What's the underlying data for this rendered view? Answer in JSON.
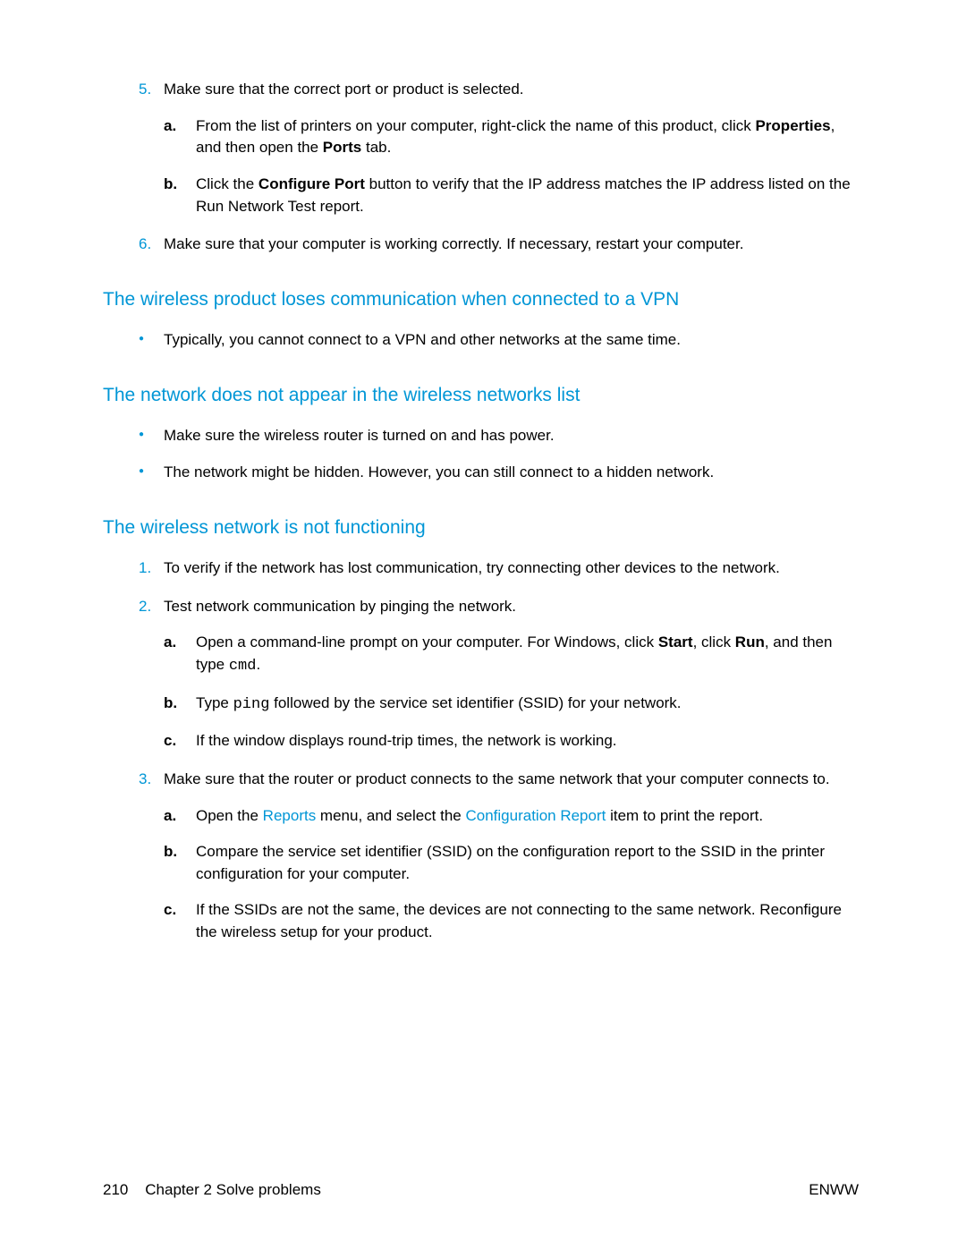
{
  "section1": {
    "item5_text": "Make sure that the correct port or product is selected.",
    "sub_a_1": "From the list of printers on your computer, right-click the name of this product, click ",
    "sub_a_b1": "Properties",
    "sub_a_2": ", and then open the ",
    "sub_a_b2": "Ports",
    "sub_a_3": " tab.",
    "sub_b_1": "Click the ",
    "sub_b_b1": "Configure Port",
    "sub_b_2": " button to verify that the IP address matches the IP address listed on the Run Network Test report.",
    "item6_text": "Make sure that your computer is working correctly. If necessary, restart your computer."
  },
  "heading1": "The wireless product loses communication when connected to a VPN",
  "vpn_bullet": "Typically, you cannot connect to a VPN and other networks at the same time.",
  "heading2": "The network does not appear in the wireless networks list",
  "net_bullet1": "Make sure the wireless router is turned on and has power.",
  "net_bullet2": "The network might be hidden. However, you can still connect to a hidden network.",
  "heading3": "The wireless network is not functioning",
  "func": {
    "item1": "To verify if the network has lost communication, try connecting other devices to the network.",
    "item2": "Test network communication by pinging the network.",
    "sub2a_1": "Open a command-line prompt on your computer. For Windows, click ",
    "sub2a_b1": "Start",
    "sub2a_2": ", click ",
    "sub2a_b2": "Run",
    "sub2a_3": ", and then type ",
    "sub2a_m": "cmd",
    "sub2a_4": ".",
    "sub2b_1": "Type ",
    "sub2b_m": "ping",
    "sub2b_2": " followed by the service set identifier (SSID) for your network.",
    "sub2c": "If the window displays round-trip times, the network is working.",
    "item3": "Make sure that the router or product connects to the same network that your computer connects to.",
    "sub3a_1": "Open the ",
    "sub3a_l1": "Reports",
    "sub3a_2": " menu, and select the ",
    "sub3a_l2": "Configuration Report",
    "sub3a_3": " item to print the report.",
    "sub3b": "Compare the service set identifier (SSID) on the configuration report to the SSID in the printer configuration for your computer.",
    "sub3c": "If the SSIDs are not the same, the devices are not connecting to the same network. Reconfigure the wireless setup for your product."
  },
  "footer": {
    "page": "210",
    "chapter": "Chapter 2   Solve problems",
    "right": "ENWW"
  }
}
